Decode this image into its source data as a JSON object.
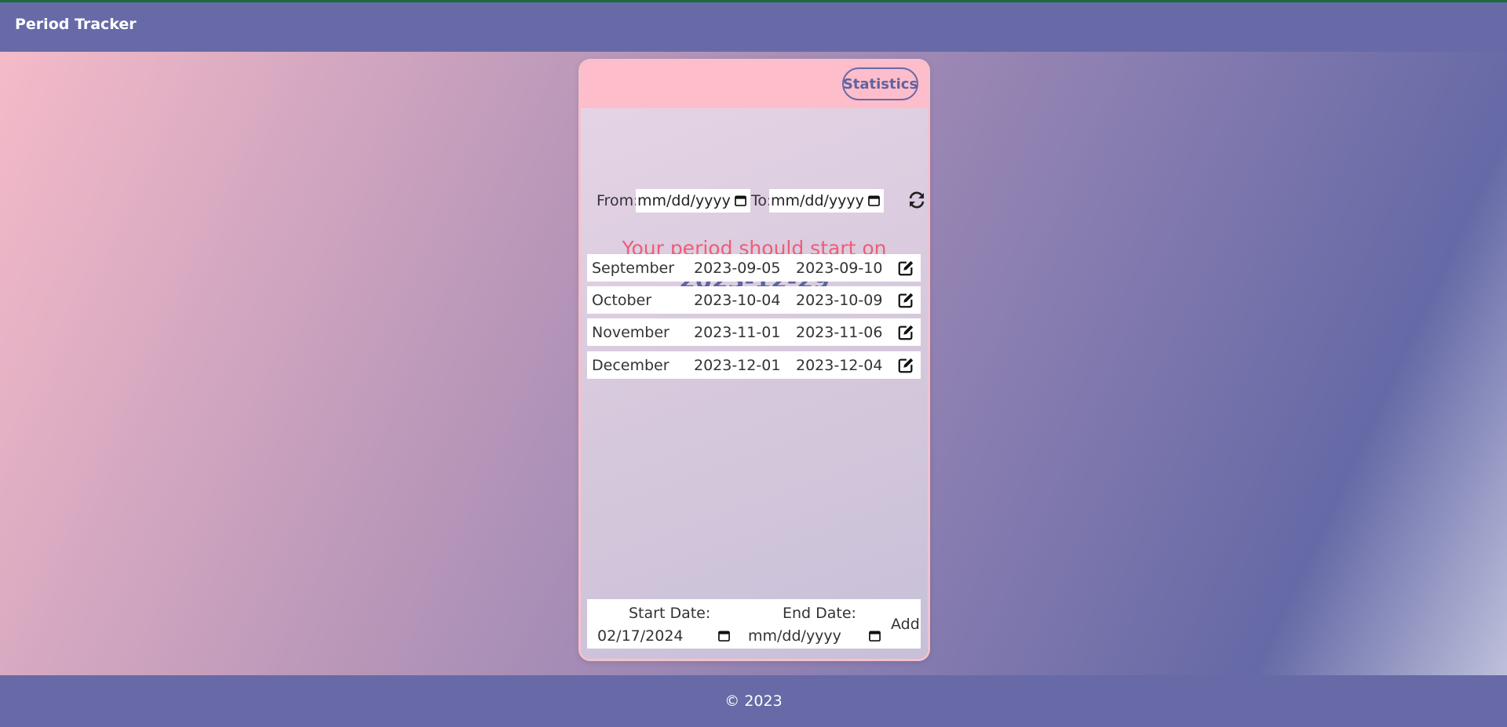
{
  "app": {
    "title": "Period Tracker"
  },
  "header": {
    "statistics_label": "Statistics"
  },
  "filter": {
    "from_label": "From:",
    "from_value": "mm/dd/yyyy",
    "to_label": "To:",
    "to_value": "mm/dd/yyyy",
    "refresh_icon": "refresh-icon"
  },
  "prediction": {
    "headline": "Your period should start on",
    "date": "2023-12-29"
  },
  "cycles": [
    {
      "month": "September",
      "start": "2023-09-05",
      "end": "2023-09-10"
    },
    {
      "month": "October",
      "start": "2023-10-04",
      "end": "2023-10-09"
    },
    {
      "month": "November",
      "start": "2023-11-01",
      "end": "2023-11-06"
    },
    {
      "month": "December",
      "start": "2023-12-01",
      "end": "2023-12-04"
    }
  ],
  "add_form": {
    "start_label": "Start Date:",
    "start_value": "02/17/2024",
    "end_label": "End Date:",
    "end_value": "mm/dd/yyyy",
    "add_label": "Add"
  },
  "footer": {
    "text": "© 2023"
  },
  "colors": {
    "navbar": "#676aa7",
    "header_pink": "#fdbdca",
    "accent_text": "#ee5d78",
    "date_text": "#5f63a0"
  }
}
